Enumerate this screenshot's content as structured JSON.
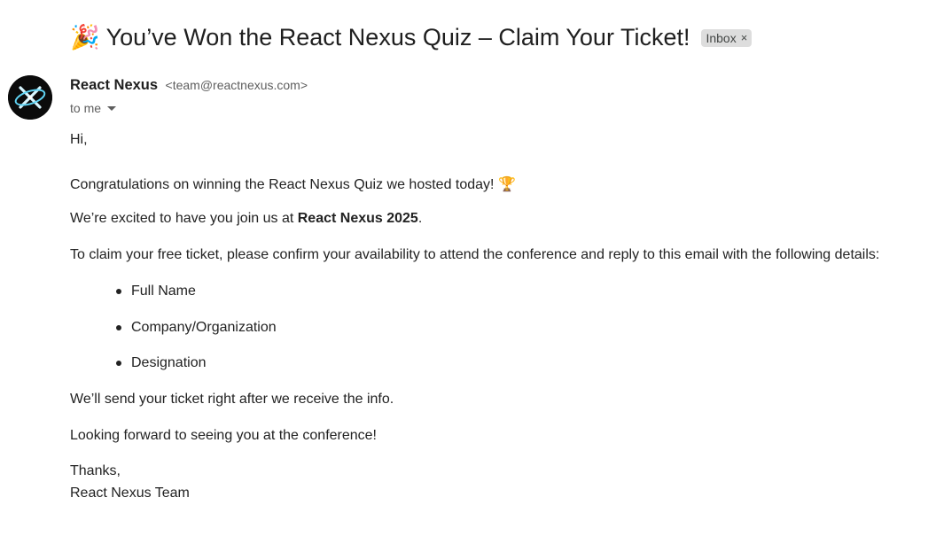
{
  "email": {
    "subject_emoji": "🎉",
    "subject": "You’ve Won the React Nexus Quiz – Claim Your Ticket!",
    "label": "Inbox",
    "label_remove": "×",
    "sender_name": "React Nexus",
    "sender_email": "<team@reactnexus.com>",
    "recipient": "to me",
    "greeting": "Hi,",
    "congrats": "Congratulations on winning the React Nexus Quiz we hosted today!",
    "trophy": "🏆",
    "excited_pre": "We’re excited to have you join us at ",
    "excited_bold": "React Nexus 2025",
    "excited_post": ".",
    "claim": "To claim your free ticket, please confirm your availability to attend the conference and reply to this email with the following details:",
    "details": [
      "Full Name",
      "Company/Organization",
      "Designation"
    ],
    "send": "We’ll send your ticket right after we receive the info.",
    "looking": "Looking forward to seeing you at the conference!",
    "thanks": "Thanks,",
    "signature": "React Nexus Team"
  },
  "icons": {
    "avatar": "react-nexus-logo",
    "caret": "caret-down-icon"
  },
  "colors": {
    "avatar_bg": "#0b0b0b",
    "chip_bg": "#dddddd",
    "text": "#222222"
  }
}
